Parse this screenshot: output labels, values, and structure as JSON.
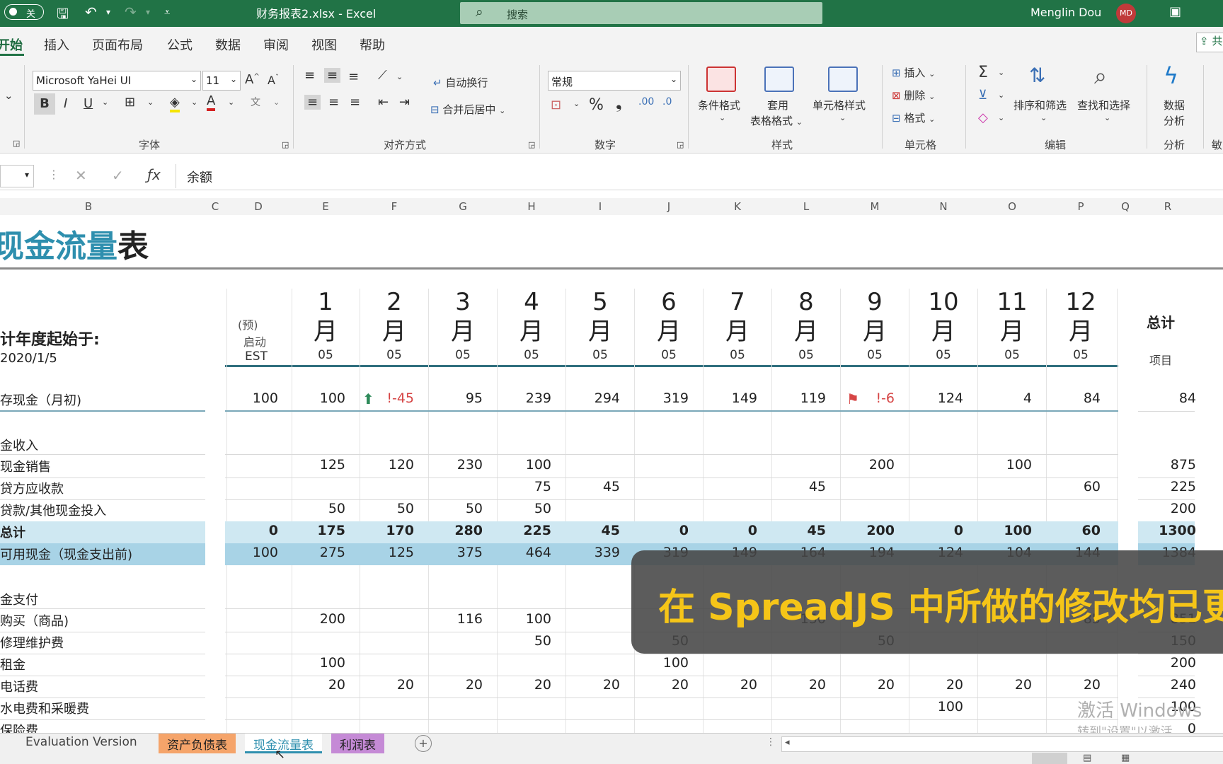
{
  "titlebar": {
    "autosave": "关",
    "file_title": "财务报表2.xlsx  -  Excel",
    "search_placeholder": "搜索",
    "user": "Menglin Dou",
    "avatar": "MD"
  },
  "menu": [
    "开始",
    "插入",
    "页面布局",
    "公式",
    "数据",
    "审阅",
    "视图",
    "帮助"
  ],
  "share": "共",
  "ribbon": {
    "font_name": "Microsoft YaHei UI",
    "font_size": "11",
    "wrap_text": "自动换行",
    "merge_center": "合并后居中",
    "number_format": "常规",
    "conditional_format": "条件格式",
    "table_format_1": "套用",
    "table_format_2": "表格格式",
    "cell_styles": "单元格样式",
    "insert": "插入",
    "delete": "删除",
    "format": "格式",
    "sort_filter": "排序和筛选",
    "find_select": "查找和选择",
    "analyze_1": "数据",
    "analyze_2": "分析",
    "groups": {
      "font": "字体",
      "alignment": "对齐方式",
      "number": "数字",
      "styles": "样式",
      "cells": "单元格",
      "editing": "编辑",
      "analysis": "分析",
      "sensitivity": "敏"
    }
  },
  "formula_bar": {
    "content": "余额"
  },
  "columns": [
    "B",
    "C",
    "D",
    "E",
    "F",
    "G",
    "H",
    "I",
    "J",
    "K",
    "L",
    "M",
    "N",
    "O",
    "P",
    "Q",
    "R"
  ],
  "sheet": {
    "title_colored": "现金流量",
    "title_plain": "表",
    "fiscal_label": "计年度起始于:",
    "fiscal_date": "2020/1/5",
    "pre_1": "(预)",
    "pre_2": "启动",
    "pre_3": "EST",
    "months": [
      "1",
      "2",
      "3",
      "4",
      "5",
      "6",
      "7",
      "8",
      "9",
      "10",
      "11",
      "12"
    ],
    "month_char": "月",
    "day": "05",
    "total_label": "总计",
    "item_label": "项目",
    "cash_in_header": "金收入",
    "cash_out_header": "金支付"
  },
  "rows": {
    "opening": {
      "label": "存现金（月初)",
      "values": [
        "100",
        "100",
        "!-45",
        "95",
        "239",
        "294",
        "319",
        "149",
        "119",
        "!-6",
        "124",
        "4",
        "84"
      ],
      "total": "84"
    },
    "cash_sales": {
      "label": "现金销售",
      "values": [
        "",
        "125",
        "120",
        "230",
        "100",
        "",
        "",
        "",
        "",
        "200",
        "",
        "100",
        ""
      ],
      "total": "875"
    },
    "receivables": {
      "label": "贷方应收款",
      "values": [
        "",
        "",
        "",
        "",
        "75",
        "45",
        "",
        "",
        "45",
        "",
        "",
        "",
        "60"
      ],
      "total": "225"
    },
    "loans": {
      "label": "贷款/其他现金投入",
      "values": [
        "",
        "50",
        "50",
        "50",
        "50",
        "",
        "",
        "",
        "",
        "",
        "",
        "",
        ""
      ],
      "total": "200"
    },
    "total_in": {
      "label": "总计",
      "values": [
        "0",
        "175",
        "170",
        "280",
        "225",
        "45",
        "0",
        "0",
        "45",
        "200",
        "0",
        "100",
        "60"
      ],
      "total": "1300"
    },
    "available": {
      "label": "可用现金（现金支出前)",
      "values": [
        "100",
        "275",
        "125",
        "375",
        "464",
        "339",
        "319",
        "149",
        "164",
        "194",
        "124",
        "104",
        "144"
      ],
      "total": "1384"
    },
    "purchases": {
      "label": "购买（商品)",
      "values": [
        "",
        "200",
        "",
        "116",
        "100",
        "",
        "",
        "",
        "150",
        "",
        "",
        "",
        "85"
      ],
      "total": "851"
    },
    "repairs": {
      "label": "修理维护费",
      "values": [
        "",
        "",
        "",
        "",
        "50",
        "",
        "50",
        "",
        "",
        "50",
        "",
        "",
        ""
      ],
      "total": "150"
    },
    "rent": {
      "label": "租金",
      "values": [
        "",
        "100",
        "",
        "",
        "",
        "",
        "100",
        "",
        "",
        "",
        "",
        "",
        ""
      ],
      "total": "200"
    },
    "phone": {
      "label": "电话费",
      "values": [
        "",
        "20",
        "20",
        "20",
        "20",
        "20",
        "20",
        "20",
        "20",
        "20",
        "20",
        "20",
        "20"
      ],
      "total": "240"
    },
    "utilities": {
      "label": "水电费和采暖费",
      "values": [
        "",
        "",
        "",
        "",
        "",
        "",
        "",
        "",
        "",
        "",
        "100",
        "",
        ""
      ],
      "total": "100"
    },
    "insurance": {
      "label": "保险费",
      "values": [
        "",
        "",
        "",
        "",
        "",
        "",
        "",
        "",
        "",
        "",
        "",
        "",
        ""
      ],
      "total": "0"
    }
  },
  "sheet_tabs": [
    "Evaluation Version",
    "资产负债表",
    "现金流量表",
    "利润表"
  ],
  "subtitle": "在 SpreadJS 中所做的修改均已更新",
  "watermark_1": "激活 Windows",
  "watermark_2": "转到\"设置\"以激活Windows",
  "colors": {
    "excel_green": "#217346",
    "title_blue": "#2e8fae",
    "band_light": "#cfe8f2",
    "band_dark": "#a8d3e6",
    "negative": "#d64545"
  }
}
